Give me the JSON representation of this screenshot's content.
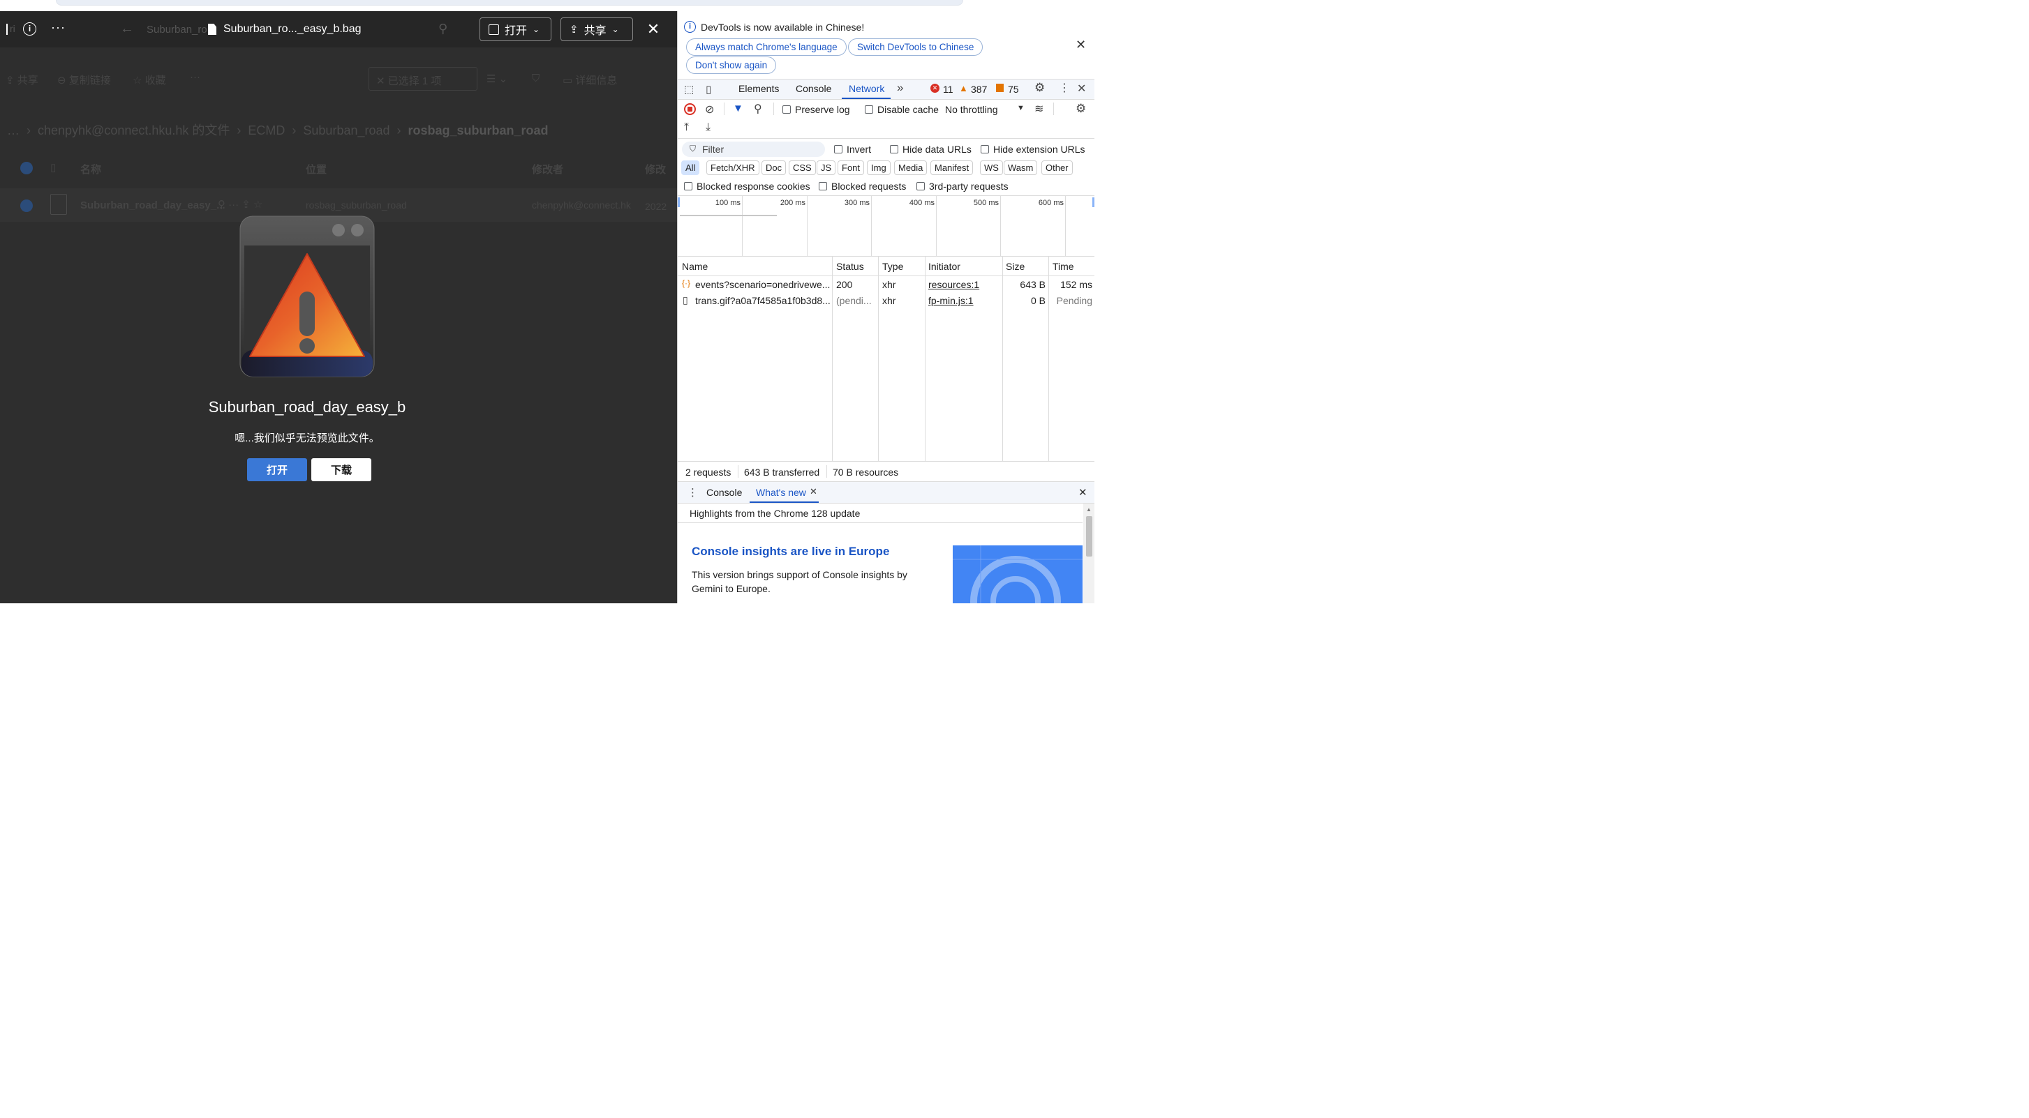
{
  "viewer": {
    "toolbar": {
      "file_name": "Suburban_ro..._easy_b.bag",
      "behind_search": "Suburban_ro",
      "open_label": "打开",
      "share_label": "共享"
    },
    "background": {
      "cmd_share": "共享",
      "cmd_copy_link": "复制链接",
      "cmd_favorite": "收藏",
      "cmd_selected": "已选择 1 项",
      "cmd_details": "详细信息",
      "breadcrumb": [
        "…",
        "chenpyhk@connect.hku.hk 的文件",
        "ECMD",
        "Suburban_road",
        "rosbag_suburban_road"
      ],
      "columns": [
        "名称",
        "位置",
        "修改者",
        "修改"
      ],
      "row": {
        "name": "Suburban_road_day_easy_...",
        "location": "rosbag_suburban_road",
        "modified_by": "chenpyhk@connect.hk",
        "modified": "2022"
      }
    },
    "preview": {
      "title": "Suburban_road_day_easy_b",
      "message": "嗯...我们似乎无法预览此文件。",
      "open_button": "打开",
      "download_button": "下载"
    }
  },
  "devtools": {
    "banner": {
      "text": "DevTools is now available in Chinese!",
      "btn_match": "Always match Chrome's language",
      "btn_switch": "Switch DevTools to Chinese",
      "btn_dont_show": "Don't show again"
    },
    "tabs": {
      "elements": "Elements",
      "console": "Console",
      "network": "Network",
      "errors": "11",
      "warnings": "387",
      "issues": "75"
    },
    "network_toolbar": {
      "preserve_log": "Preserve log",
      "disable_cache": "Disable cache",
      "throttling": "No throttling"
    },
    "filter": {
      "placeholder": "Filter",
      "invert": "Invert",
      "hide_data_urls": "Hide data URLs",
      "hide_extension_urls": "Hide extension URLs",
      "types": [
        "All",
        "Fetch/XHR",
        "Doc",
        "CSS",
        "JS",
        "Font",
        "Img",
        "Media",
        "Manifest",
        "WS",
        "Wasm",
        "Other"
      ],
      "blocked_cookies": "Blocked response cookies",
      "blocked_requests": "Blocked requests",
      "third_party": "3rd-party requests"
    },
    "timeline_ticks": [
      "100 ms",
      "200 ms",
      "300 ms",
      "400 ms",
      "500 ms",
      "600 ms"
    ],
    "table": {
      "headers": [
        "Name",
        "Status",
        "Type",
        "Initiator",
        "Size",
        "Time"
      ],
      "rows": [
        {
          "name": "events?scenario=onedrivewe...",
          "status": "200",
          "type": "xhr",
          "initiator": "resources:1",
          "size": "643 B",
          "time": "152 ms"
        },
        {
          "name": "trans.gif?a0a7f4585a1f0b3d8...",
          "status": "(pendi...",
          "type": "xhr",
          "initiator": "fp-min.js:1",
          "size": "0 B",
          "time": "Pending"
        }
      ]
    },
    "status_bar": {
      "requests": "2 requests",
      "transferred": "643 B transferred",
      "resources": "70 B resources"
    },
    "drawer": {
      "tab_console": "Console",
      "tab_whats_new": "What's new",
      "highlights": "Highlights from the Chrome 128 update",
      "article_title": "Console insights are live in Europe",
      "article_body_1": "This version brings support of Console insights by",
      "article_body_2": "Gemini to Europe."
    }
  }
}
